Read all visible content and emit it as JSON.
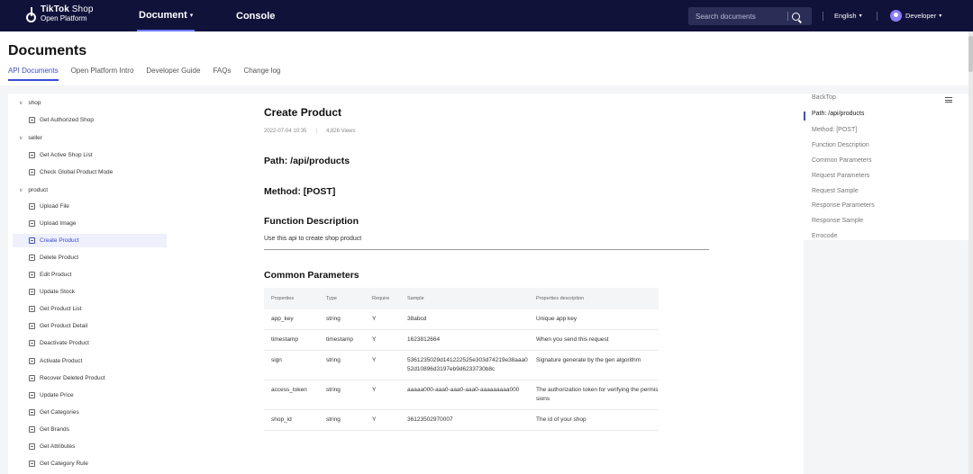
{
  "topbar": {
    "logo_line1_bold": "TikTok",
    "logo_line1_light": " Shop",
    "logo_line2": "Open Platform",
    "nav_document": "Document",
    "nav_console": "Console",
    "search_placeholder": "Search documents",
    "language": "English",
    "user": "Developer"
  },
  "header": {
    "title": "Documents",
    "tabs": [
      "API Documents",
      "Open Platform Intro",
      "Developer Guide",
      "FAQs",
      "Change log"
    ]
  },
  "sidebar": {
    "groups": {
      "shop": "shop",
      "seller": "seller",
      "product": "product"
    },
    "items": [
      "Get Authorized Shop",
      "Get Active Shop List",
      "Check Global Product Mode",
      "Upload File",
      "Upload Image",
      "Create Product",
      "Delete Product",
      "Edit Product",
      "Update Stock",
      "Get Product List",
      "Get Product Detail",
      "Deactivate Product",
      "Activate Product",
      "Recover Deleted Product",
      "Update Price",
      "Get Categories",
      "Get Brands",
      "Get Attributes",
      "Get Category Rule"
    ]
  },
  "content": {
    "title": "Create Product",
    "date": "2022-07-04 10:35",
    "views": "4,826 Views",
    "path": "Path: /api/products",
    "method": "Method: [POST]",
    "function_heading": "Function Description",
    "function_desc": "Use this api to create shop product",
    "common_heading": "Common Parameters",
    "table": {
      "headers": [
        "Properties",
        "Type",
        "Require",
        "Sample",
        "Properties description"
      ],
      "rows": [
        [
          "app_key",
          "string",
          "Y",
          "38abcd",
          "Unique app key"
        ],
        [
          "timestamp",
          "timestamp",
          "Y",
          "1623812664",
          "When you send this request"
        ],
        [
          "sign",
          "string",
          "Y",
          "5361235029d141222525e303d74219e38aaa052d10896d3197eb9d6233730b8c",
          "Signature generate by the gen algorithm"
        ],
        [
          "access_token",
          "string",
          "Y",
          "aaaaa000-aaa0-aaa0-aaa0-aaaaaaaaa000",
          "The authorization token for verifying the permissions"
        ],
        [
          "shop_id",
          "string",
          "Y",
          "36123502970007",
          "The id of your shop"
        ]
      ]
    }
  },
  "toc": {
    "items": [
      "BackTop",
      "Path: /api/products",
      "Method: [POST]",
      "Function Description",
      "Common Parameters",
      "Request Parameters",
      "Request Sample",
      "Response Parameters",
      "Response Sample",
      "Errocode"
    ]
  }
}
